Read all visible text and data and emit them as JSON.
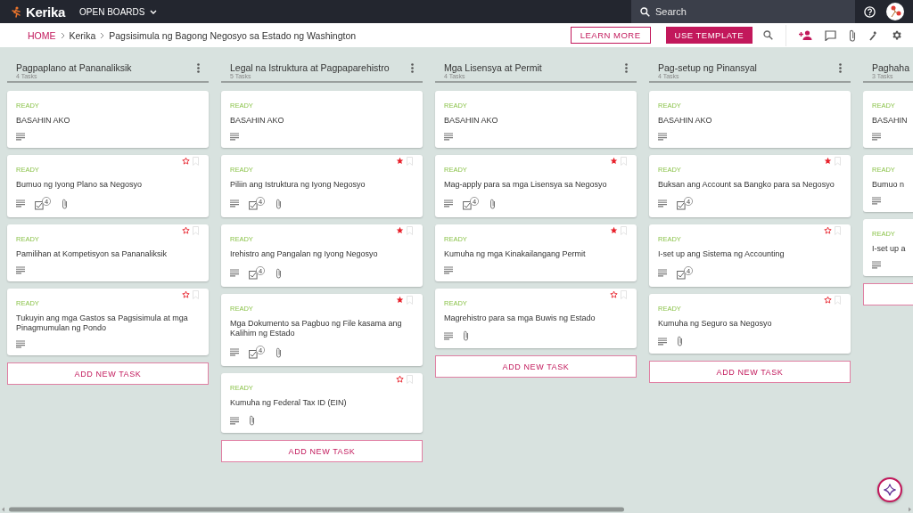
{
  "topbar": {
    "logo": "Kerika",
    "boards_menu": "OPEN BOARDS",
    "search": {
      "placeholder": "Search"
    }
  },
  "breadcrumb": {
    "items": [
      "HOME",
      "Kerika",
      "Pagsisimula ng Bagong Negosyo sa Estado ng Washington"
    ]
  },
  "actions": {
    "learn_more": "LEARN MORE",
    "use_template": "USE TEMPLATE"
  },
  "columns": [
    {
      "title": "Pagpaplano at Pananaliksik",
      "count": "4 Tasks",
      "add_task": "ADD NEW TASK",
      "cards": [
        {
          "kind": "readme",
          "status": "READY",
          "title": "BASAHIN AKO",
          "badges": [
            {
              "kind": "description"
            }
          ]
        },
        {
          "kind": "task",
          "status": "READY",
          "title": "Bumuo ng Iyong Plano sa Negosyo",
          "starred": false,
          "badges": [
            {
              "kind": "description"
            },
            {
              "kind": "checklist",
              "count": "4"
            },
            {
              "kind": "attachment"
            }
          ]
        },
        {
          "kind": "task",
          "status": "READY",
          "title": "Pamilihan at Kompetisyon sa Pananaliksik",
          "starred": false,
          "badges": [
            {
              "kind": "description"
            }
          ]
        },
        {
          "kind": "task",
          "status": "READY",
          "title": "Tukuyin ang mga Gastos sa Pagsisimula at mga Pinagmumulan ng Pondo",
          "starred": false,
          "badges": [
            {
              "kind": "description"
            }
          ]
        }
      ]
    },
    {
      "title": "Legal na Istruktura at Pagpaparehistro",
      "count": "5 Tasks",
      "add_task": "ADD NEW TASK",
      "cards": [
        {
          "kind": "readme",
          "status": "READY",
          "title": "BASAHIN AKO",
          "badges": [
            {
              "kind": "description"
            }
          ]
        },
        {
          "kind": "task",
          "status": "READY",
          "title": "Piliin ang Istruktura ng Iyong Negosyo",
          "starred": true,
          "badges": [
            {
              "kind": "description"
            },
            {
              "kind": "checklist",
              "count": "4"
            },
            {
              "kind": "attachment"
            }
          ]
        },
        {
          "kind": "task",
          "status": "READY",
          "title": "Irehistro ang Pangalan ng Iyong Negosyo",
          "starred": true,
          "badges": [
            {
              "kind": "description"
            },
            {
              "kind": "checklist",
              "count": "4"
            },
            {
              "kind": "attachment"
            }
          ]
        },
        {
          "kind": "task",
          "status": "READY",
          "title": "Mga Dokumento sa Pagbuo ng File kasama ang Kalihim ng Estado",
          "starred": true,
          "badges": [
            {
              "kind": "description"
            },
            {
              "kind": "checklist",
              "count": "4"
            },
            {
              "kind": "attachment"
            }
          ]
        },
        {
          "kind": "task",
          "status": "READY",
          "title": "Kumuha ng Federal Tax ID (EIN)",
          "starred": false,
          "badges": [
            {
              "kind": "description"
            },
            {
              "kind": "attachment"
            }
          ]
        }
      ]
    },
    {
      "title": "Mga Lisensya at Permit",
      "count": "4 Tasks",
      "add_task": "ADD NEW TASK",
      "cards": [
        {
          "kind": "readme",
          "status": "READY",
          "title": "BASAHIN AKO",
          "badges": [
            {
              "kind": "description"
            }
          ]
        },
        {
          "kind": "task",
          "status": "READY",
          "title": "Mag-apply para sa mga Lisensya sa Negosyo",
          "starred": true,
          "badges": [
            {
              "kind": "description"
            },
            {
              "kind": "checklist",
              "count": "4"
            },
            {
              "kind": "attachment"
            }
          ]
        },
        {
          "kind": "task",
          "status": "READY",
          "title": "Kumuha ng mga Kinakailangang Permit",
          "starred": true,
          "badges": [
            {
              "kind": "description"
            }
          ]
        },
        {
          "kind": "task",
          "status": "READY",
          "title": "Magrehistro para sa mga Buwis ng Estado",
          "starred": false,
          "badges": [
            {
              "kind": "description"
            },
            {
              "kind": "attachment"
            }
          ]
        }
      ]
    },
    {
      "title": "Pag-setup ng Pinansyal",
      "count": "4 Tasks",
      "add_task": "ADD NEW TASK",
      "cards": [
        {
          "kind": "readme",
          "status": "READY",
          "title": "BASAHIN AKO",
          "badges": [
            {
              "kind": "description"
            }
          ]
        },
        {
          "kind": "task",
          "status": "READY",
          "title": "Buksan ang Account sa Bangko para sa Negosyo",
          "starred": true,
          "badges": [
            {
              "kind": "description"
            },
            {
              "kind": "checklist",
              "count": "4"
            }
          ]
        },
        {
          "kind": "task",
          "status": "READY",
          "title": "I-set up ang Sistema ng Accounting",
          "starred": false,
          "badges": [
            {
              "kind": "description"
            },
            {
              "kind": "checklist",
              "count": "4"
            }
          ]
        },
        {
          "kind": "task",
          "status": "READY",
          "title": "Kumuha ng Seguro sa Negosyo",
          "starred": false,
          "badges": [
            {
              "kind": "description"
            },
            {
              "kind": "attachment"
            }
          ]
        }
      ]
    },
    {
      "title": "Paghaha",
      "count": "3 Tasks",
      "add_task": true,
      "cards": [
        {
          "kind": "readme",
          "status": "READY",
          "title": "BASAHIN",
          "badges": [
            {
              "kind": "description"
            }
          ]
        },
        {
          "kind": "task",
          "status": "READY",
          "title": "Bumuo n",
          "badges": [
            {
              "kind": "description"
            }
          ]
        },
        {
          "kind": "task",
          "status": "READY",
          "title": "I-set up a",
          "badges": [
            {
              "kind": "description"
            }
          ]
        }
      ]
    }
  ]
}
